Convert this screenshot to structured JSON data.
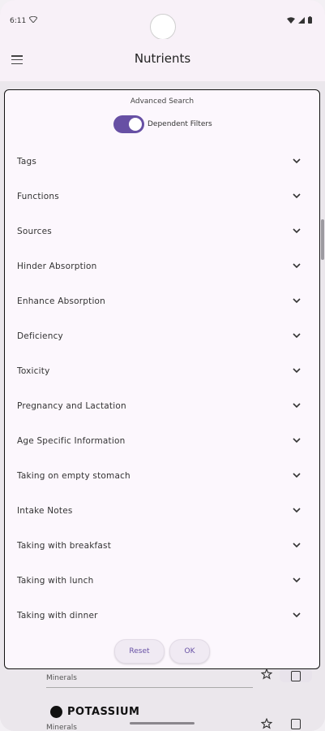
{
  "status_bar": {
    "time": "6:11"
  },
  "app_bar": {
    "title": "Nutrients"
  },
  "background_list": {
    "rows": [
      {
        "category": "Minerals"
      },
      {
        "title": "POTASSIUM",
        "category": "Minerals"
      }
    ]
  },
  "dialog": {
    "title": "Advanced Search",
    "switch_label": "Dependent Filters",
    "switch_on": true,
    "filters": [
      {
        "label": "Tags"
      },
      {
        "label": "Functions"
      },
      {
        "label": "Sources"
      },
      {
        "label": "Hinder Absorption"
      },
      {
        "label": "Enhance Absorption"
      },
      {
        "label": "Deficiency"
      },
      {
        "label": "Toxicity"
      },
      {
        "label": "Pregnancy and Lactation"
      },
      {
        "label": "Age Specific Information"
      },
      {
        "label": "Taking on empty stomach"
      },
      {
        "label": "Intake Notes"
      },
      {
        "label": "Taking with breakfast"
      },
      {
        "label": "Taking with lunch"
      },
      {
        "label": "Taking with dinner"
      }
    ],
    "reset_label": "Reset",
    "ok_label": "OK"
  },
  "colors": {
    "accent": "#6750a4",
    "surface": "#fcf7fd"
  }
}
